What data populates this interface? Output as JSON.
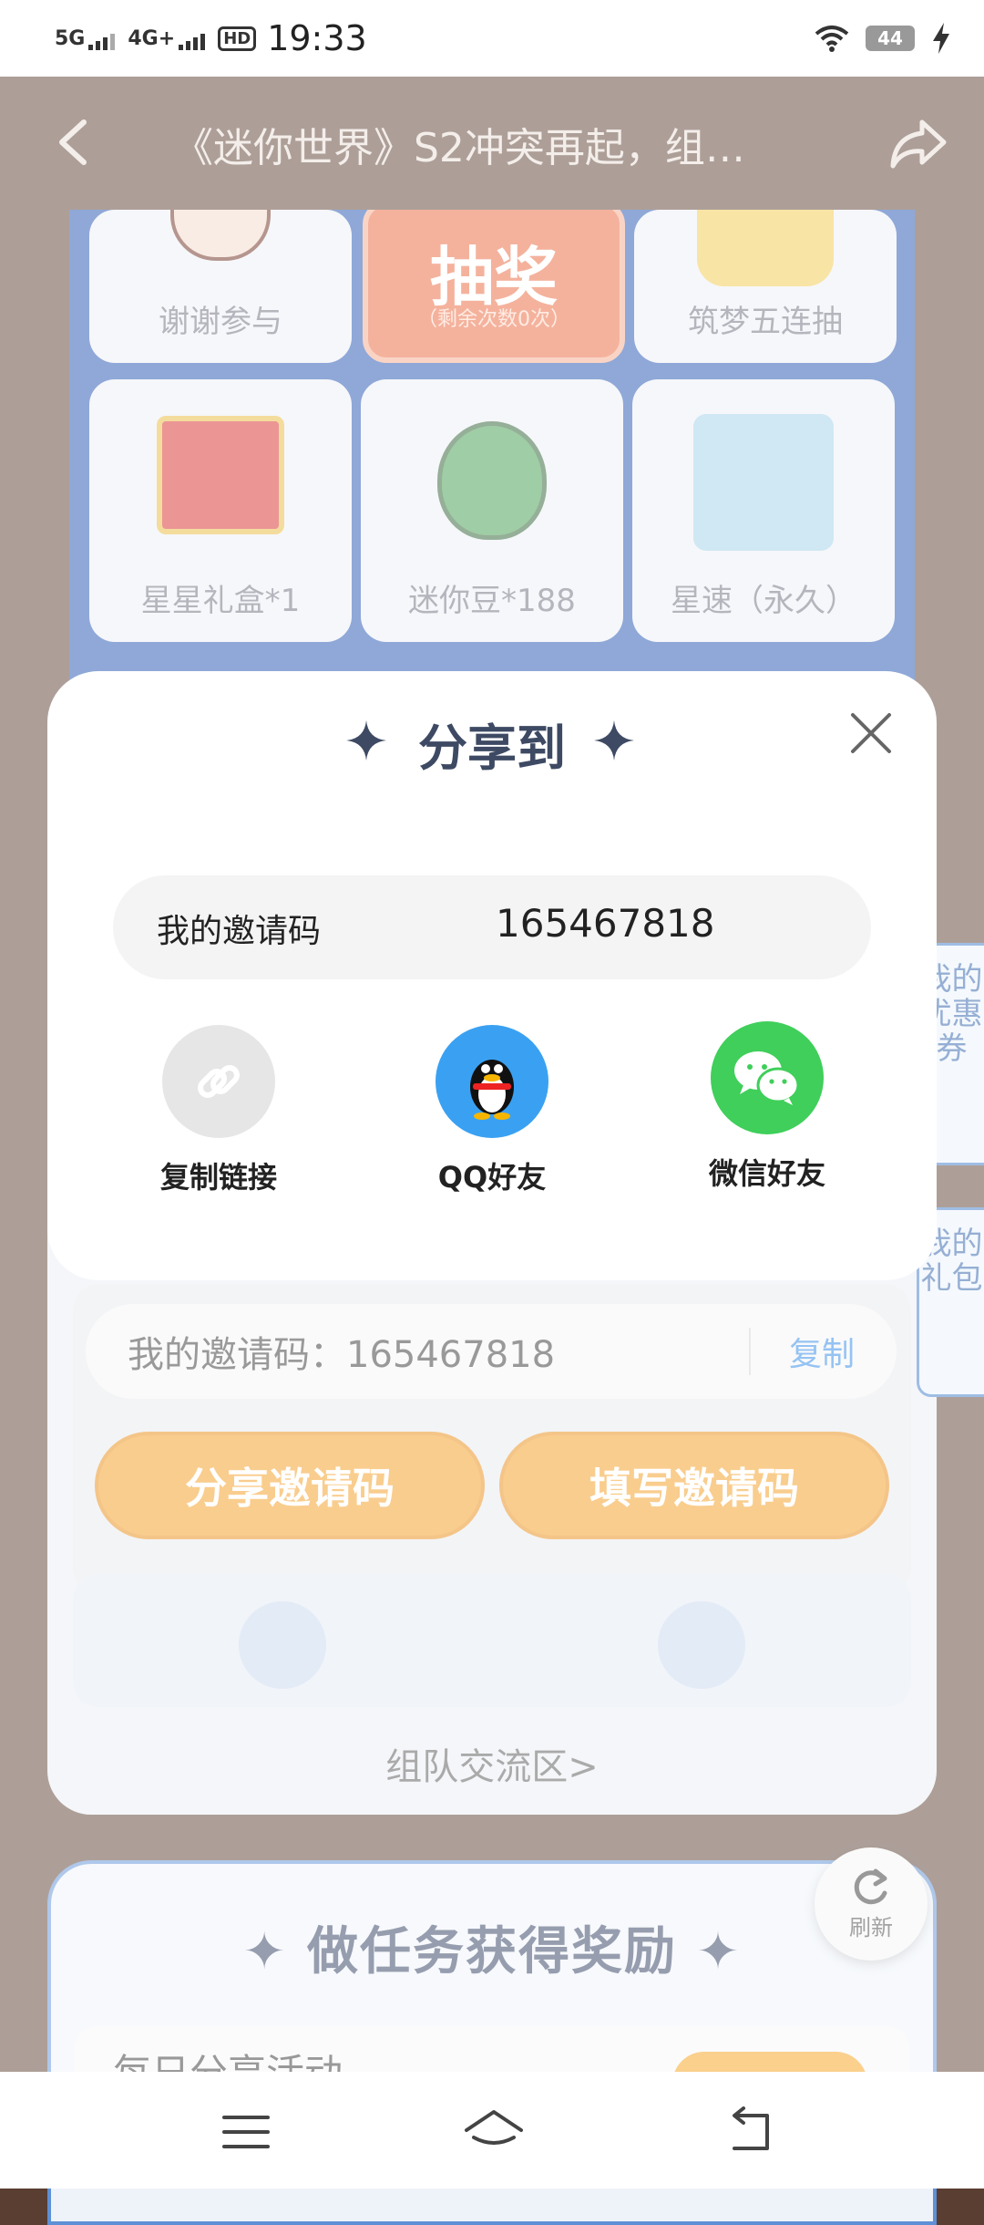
{
  "status_bar": {
    "network1": "5G",
    "network2": "4G+",
    "hd_label": "HD",
    "time": "19:33",
    "battery": "44"
  },
  "nav": {
    "title": "《迷你世界》S2冲突再起，组…"
  },
  "prizes": [
    {
      "label": "谢谢参与"
    },
    {
      "label": "筑梦五连抽"
    },
    {
      "label": "星星礼盒*1"
    },
    {
      "label": "迷你豆*188"
    },
    {
      "label": "星速（永久）"
    }
  ],
  "lottery": {
    "label": "抽奖",
    "remaining": "（剩余次数0次）"
  },
  "modal": {
    "title": "分享到",
    "code_label": "我的邀请码",
    "code_value": "165467818",
    "options": [
      {
        "label": "复制链接"
      },
      {
        "label": "QQ好友"
      },
      {
        "label": "微信好友"
      }
    ]
  },
  "invite": {
    "code_text": "我的邀请码：165467818",
    "copy_label": "复制",
    "share_button": "分享邀请码",
    "fill_button": "填写邀请码",
    "team_link": "组队交流区>"
  },
  "side_tabs": {
    "coupons": "我的优惠券",
    "gifts": "我的礼包"
  },
  "tasks": {
    "title": "做任务获得奖励",
    "row1": "每日分享活动"
  },
  "refresh_label": "刷新",
  "colors": {
    "page_bg": "#5a3e31",
    "accent_orange": "#f39a1c",
    "prize_panel_blue": "#1e50b0",
    "wechat_green": "#3fcf5a",
    "qq_blue": "#3aa1f2"
  }
}
